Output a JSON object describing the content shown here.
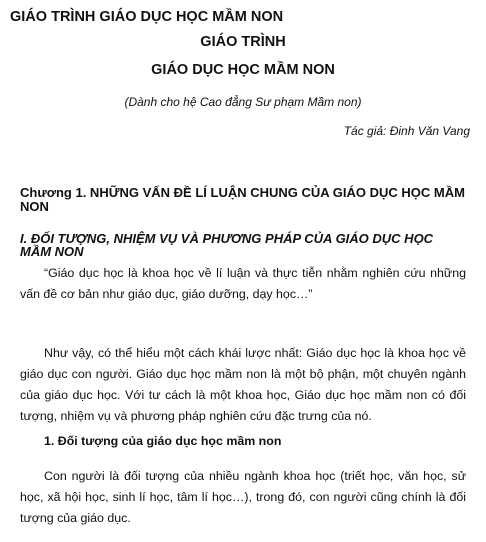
{
  "document": {
    "title": "GIÁO TRÌNH GIÁO DỤC HỌC MẦM NON",
    "center_title_line1": "GIÁO TRÌNH",
    "center_title_line2": "GIÁO DỤC HỌC MẦM NON",
    "subtitle": "(Dành cho hệ Cao đẳng Sư phạm Mầm non)",
    "author": "Tác giả: Đinh Văn Vang"
  },
  "chapter": {
    "heading": "Chương 1. NHỮNG VẤN ĐỀ LÍ LUẬN CHUNG CỦA GIÁO DỤC HỌC MẦM NON"
  },
  "section": {
    "heading": "I. ĐỐI TƯỢNG, NHIỆM VỤ VÀ PHƯƠNG PHÁP CỦA GIÁO DỤC HỌC MẦM NON",
    "paragraphs": [
      "“Giáo dục học là khoa học về lí luận và thực tiễn nhằm nghiên cứu những vấn đề cơ bản như giáo dục, giáo dưỡng, dạy học…”",
      "Như vậy, có thể hiểu một cách khái lược nhất: Giáo dục học là khoa học về giáo dục con người. Giáo dục học mầm non là một bộ phận, một chuyên ngành của giáo dục học. Với tư cách là một khoa học, Giáo dục học mầm non có đối tượng, nhiệm vụ và phương pháp nghiên cứu đặc trưng của nó."
    ]
  },
  "subsection": {
    "heading": "1. Đối tượng của giáo dục học mầm non",
    "paragraphs": [
      "Con người là đối tượng của nhiều ngành khoa học (triết học, văn học, sử học, xã hội học, sinh lí học, tâm lí học…), trong đó, con người cũng chính là đối tượng của giáo dục."
    ]
  }
}
